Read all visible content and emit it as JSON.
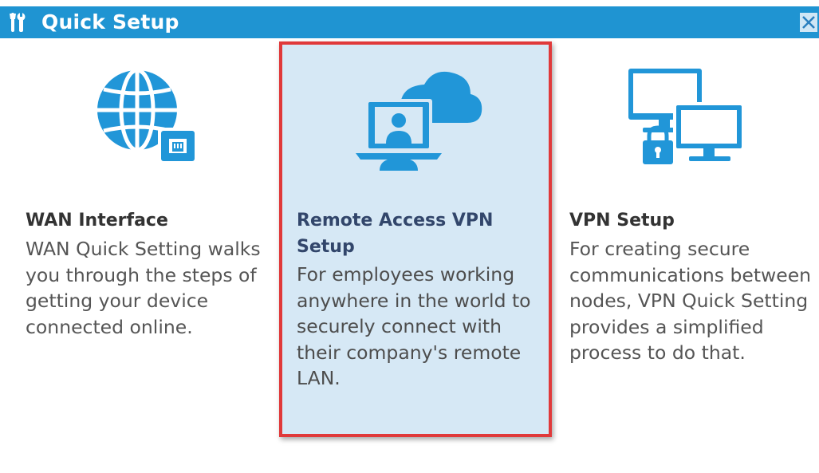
{
  "window": {
    "title": "Quick Setup",
    "close_symbol": "✕"
  },
  "colors": {
    "titlebar": "#1f94d2",
    "icon_blue": "#2196d8",
    "selected_bg": "#d6e8f5",
    "selected_border": "#e0393a"
  },
  "cards": [
    {
      "id": "wan",
      "icon": "globe-network-icon",
      "title": "WAN Interface",
      "description": "WAN Quick Setting walks you through the steps of getting your device connected online.",
      "selected": false
    },
    {
      "id": "remote-vpn",
      "icon": "remote-user-cloud-icon",
      "title": "Remote Access VPN Setup",
      "description": "For employees working anywhere in the world to securely connect with their company's remote LAN.",
      "selected": true
    },
    {
      "id": "vpn",
      "icon": "secure-monitors-icon",
      "title": "VPN Setup",
      "description": "For creating secure communications between nodes, VPN Quick Setting provides a simplified process to do that.",
      "selected": false
    }
  ]
}
